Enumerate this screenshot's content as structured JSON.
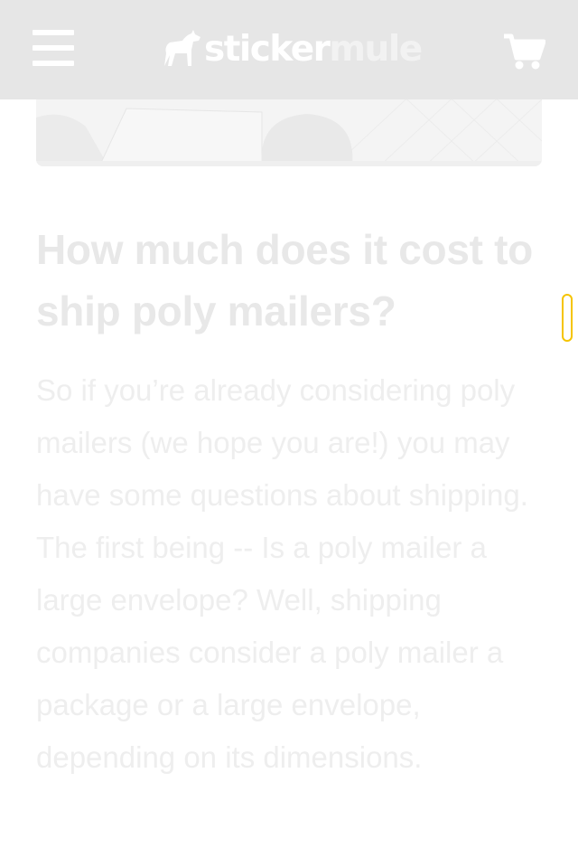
{
  "brand": {
    "name_part1": "sticker",
    "name_part2": "mule"
  },
  "header": {
    "background": "#e6e6e6",
    "menu_icon": "hamburger-menu-icon",
    "cart_icon": "shopping-cart-icon"
  },
  "article": {
    "title": "How much does it cost to ship poly mailers?",
    "paragraph": "So if you’re already considering poly mailers (we hope you are!) you may have some questions about shipping. The first being -- Is a poly mailer a large envelope? Well, shipping companies consider a poly mailer a package or a large envelope, depending on its dimensions."
  },
  "colors": {
    "scroll_indicator_border": "#f5c400"
  }
}
